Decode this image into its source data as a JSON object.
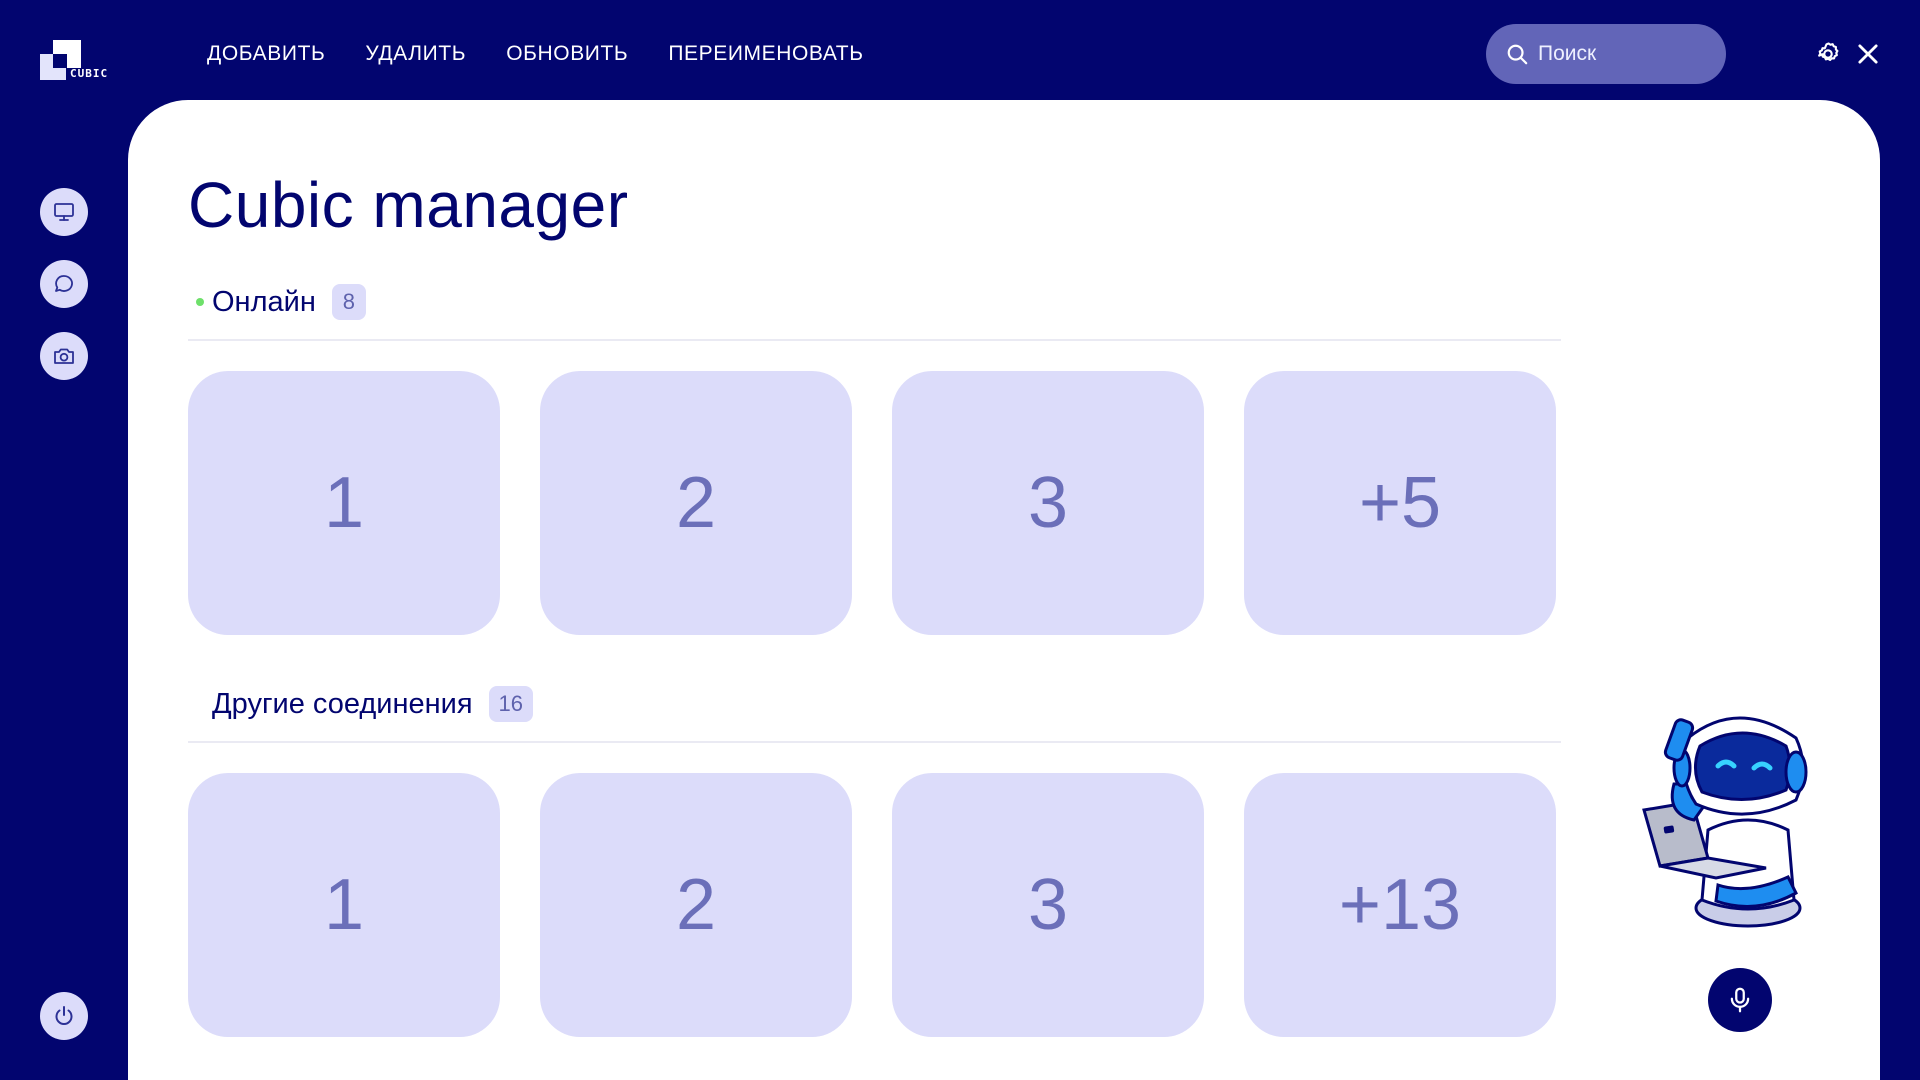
{
  "app": {
    "logo_text": "CUBIC"
  },
  "menu": {
    "items": [
      "ДОБАВИТЬ",
      "УДАЛИТЬ",
      "ОБНОВИТЬ",
      "ПЕРЕИМЕНОВАТЬ"
    ]
  },
  "search": {
    "placeholder": "Поиск",
    "icon": "search-icon"
  },
  "top_icons": [
    "gear-icon",
    "close-icon"
  ],
  "sidebar": {
    "items": [
      {
        "icon": "monitor-icon"
      },
      {
        "icon": "chat-bubble-icon"
      },
      {
        "icon": "camera-icon"
      }
    ],
    "bottom": {
      "icon": "power-icon"
    }
  },
  "page": {
    "title": "Cubic manager"
  },
  "sections": [
    {
      "label": "Онлайн",
      "count": "8",
      "status_color": "#6ee06a",
      "tiles": [
        "1",
        "2",
        "3",
        "+5"
      ]
    },
    {
      "label": "Другие соединения",
      "count": "16",
      "tiles": [
        "1",
        "2",
        "3",
        "+13"
      ]
    }
  ],
  "assistant": {
    "image": "robot-mascot",
    "mic_icon": "microphone-icon"
  },
  "colors": {
    "background": "#02056f",
    "panel": "#ffffff",
    "tile": "#dcdcfa",
    "tile_text": "#6b6fb9",
    "accent_search": "#6265b8"
  }
}
